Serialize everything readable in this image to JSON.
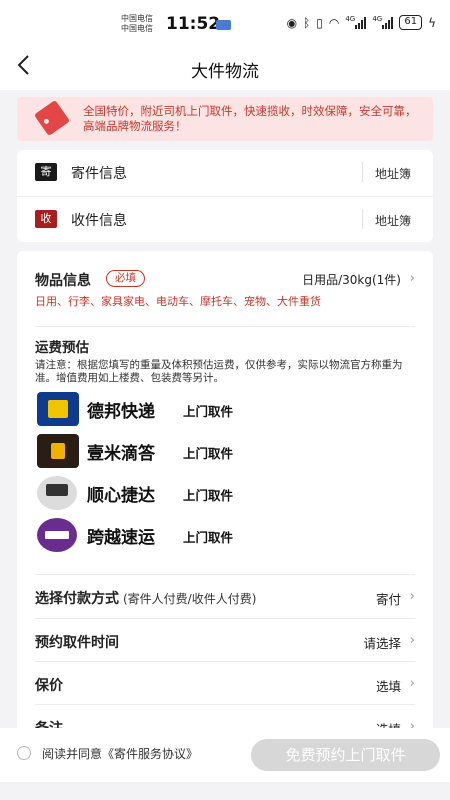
{
  "status_bar": {
    "carrier_1": "中国电信",
    "carrier_2": "中国电信",
    "time": "11:52",
    "net_1": "4G",
    "net_2": "4G",
    "battery": "61"
  },
  "nav": {
    "back_icon": "chevron-left",
    "title": "大件物流"
  },
  "banner": {
    "icon": "price-tag-icon",
    "text": "全国特价，附近司机上门取件，快速揽收，时效保障，安全可靠，高端品牌物流服务！"
  },
  "address": {
    "send": {
      "tag": "寄",
      "label": "寄件信息",
      "book": "地址簿"
    },
    "receive": {
      "tag": "收",
      "label": "收件信息",
      "book": "地址簿"
    }
  },
  "item": {
    "title": "物品信息",
    "required": "必填",
    "value": "日用品/30kg(1件)",
    "categories": "日用、行李、家具家电、电动车、摩托车、宠物、大件重货"
  },
  "fee": {
    "title": "运费预估",
    "note": "请注意：根据您填写的重量及体积预估运费，仅供参考，实际以物流官方称重为准。增值费用如上楼费、包装费等另计。"
  },
  "carriers": [
    {
      "name": "德邦快递",
      "tag": "上门取件"
    },
    {
      "name": "壹米滴答",
      "tag": "上门取件"
    },
    {
      "name": "顺心捷达",
      "tag": "上门取件"
    },
    {
      "name": "跨越速运",
      "tag": "上门取件"
    }
  ],
  "options": {
    "payment": {
      "label": "选择付款方式",
      "sub": "(寄件人付费/收件人付费)",
      "value": "寄付"
    },
    "pickup_time": {
      "label": "预约取件时间",
      "value": "请选择"
    },
    "insurance": {
      "label": "保价",
      "value": "选填"
    },
    "remark": {
      "label": "备注",
      "value": "选填"
    }
  },
  "footer": {
    "agree": "阅读并同意《寄件服务协议》",
    "submit": "免费预约上门取件"
  },
  "colors": {
    "accent_red": "#c0392b",
    "banner_bg": "#fde4e4",
    "button_disabled": "#d7d7d7"
  }
}
